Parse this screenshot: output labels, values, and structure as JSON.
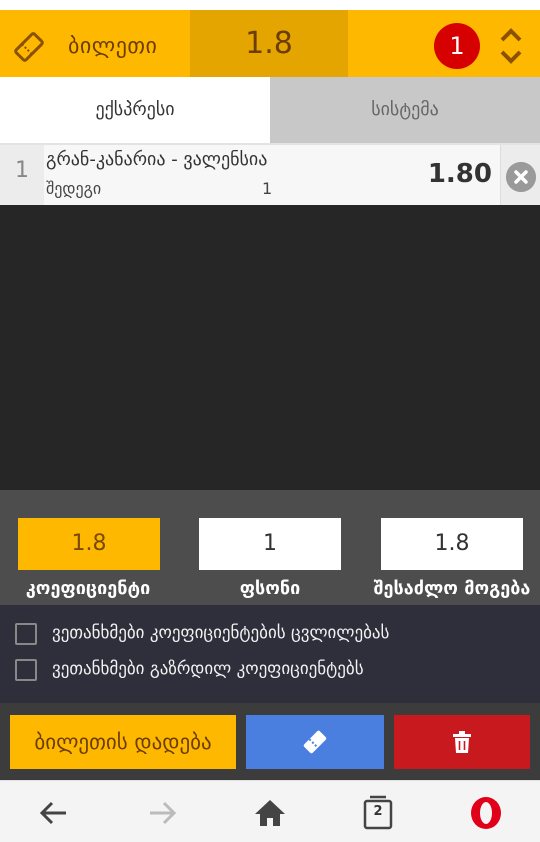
{
  "header": {
    "title": "ბილეთი",
    "total_odds": "1.8",
    "bet_count": "1",
    "ticket_icon": "ticket-icon",
    "toggle_icon": "chevron-up-down-icon"
  },
  "tabs": [
    {
      "label": "ექსპრესი",
      "active": true
    },
    {
      "label": "სისტემა",
      "active": false
    }
  ],
  "bets": [
    {
      "index": "1",
      "event": "გრან-კანარია - ვალენსია",
      "market": "შედეგი",
      "outcome": "1",
      "odds": "1.80"
    }
  ],
  "summary": {
    "odds_value": "1.8",
    "odds_label": "კოეფიციენტი",
    "stake_value": "1",
    "stake_label": "ფსონი",
    "win_value": "1.8",
    "win_label": "შესაძლო მოგება"
  },
  "options": [
    {
      "label": "ვეთანხმები კოეფიციენტების ცვლილებას",
      "checked": false
    },
    {
      "label": "ვეთანხმები გაზრდილ კოეფიციენტებს",
      "checked": false
    }
  ],
  "actions": {
    "place_label": "ბილეთის დადება",
    "ticket_icon": "ticket-icon",
    "delete_icon": "trash-icon"
  },
  "browser": {
    "tabs_count": "2",
    "icons": [
      "back-arrow-icon",
      "forward-arrow-icon",
      "home-icon",
      "tabs-icon",
      "opera-logo-icon"
    ]
  },
  "colors": {
    "accent": "#FFB800",
    "badge": "#D60000",
    "primary_button": "#4A7FE0",
    "danger_button": "#C8191F"
  }
}
